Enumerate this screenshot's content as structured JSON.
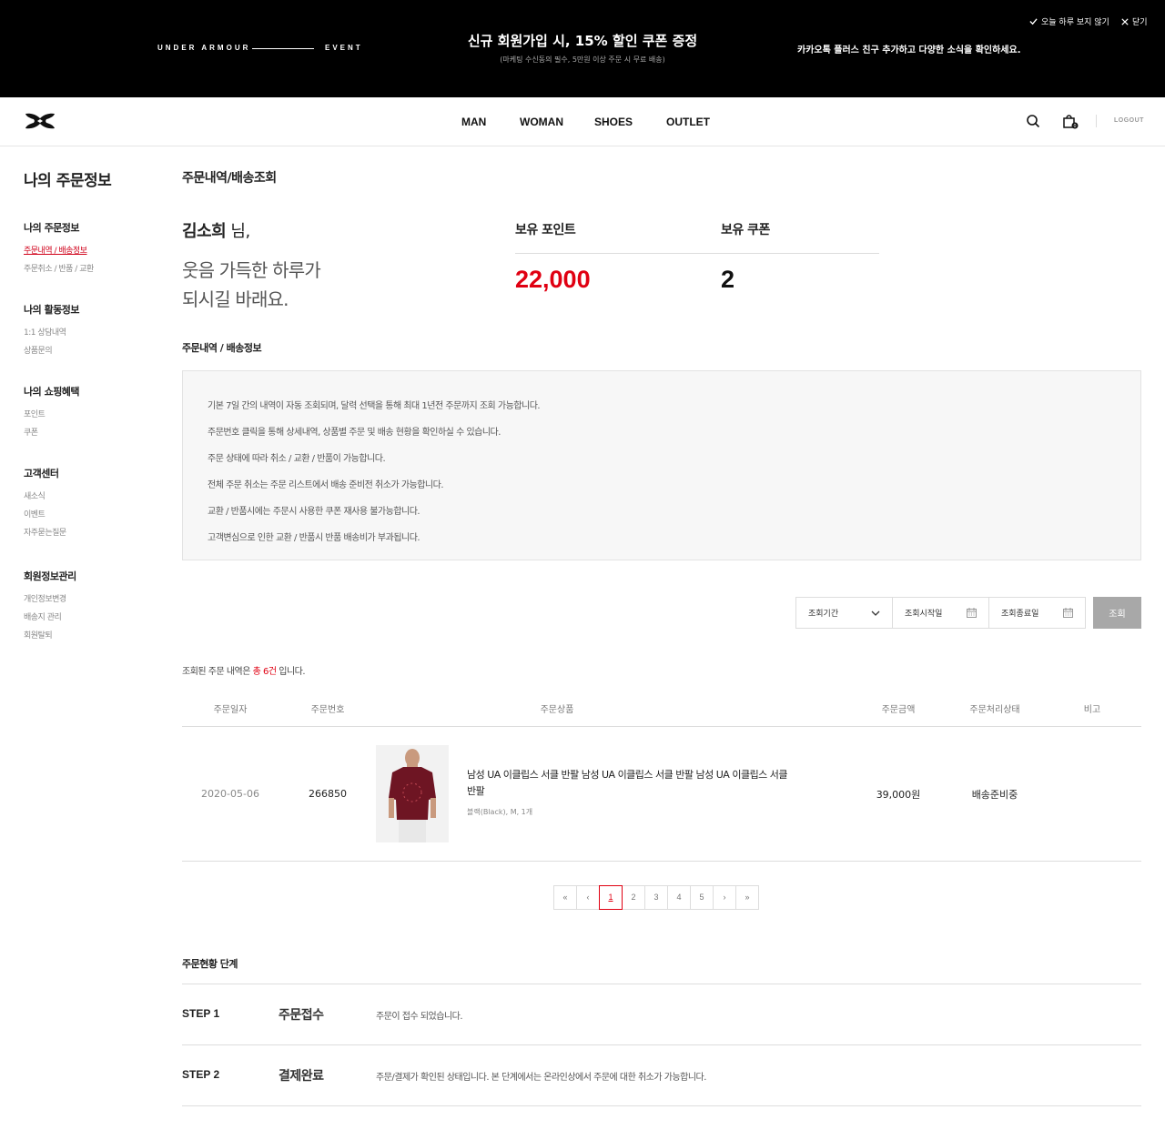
{
  "banner": {
    "brand": "UNDER ARMOUR",
    "event": "EVENT",
    "title": "신규 회원가입 시, 15% 할인 쿠폰 증정",
    "subtitle": "(마케팅 수신동의 필수, 5만원 이상 주문 시 무료 배송)",
    "kakao": "카카오톡 플러스 친구 추가하고 다양한 소식을 확인하세요.",
    "today_label": "오늘 하루 보지 않기",
    "close_label": "닫기"
  },
  "header": {
    "nav": [
      "MAN",
      "WOMAN",
      "SHOES",
      "OUTLET"
    ],
    "cart_count": "0",
    "logout": "LOGOUT"
  },
  "sidebar": {
    "title": "나의 주문정보",
    "groups": [
      {
        "title": "나의 주문정보",
        "items": [
          "주문내역 / 배송정보",
          "주문취소 / 반품 / 교환"
        ]
      },
      {
        "title": "나의 활동정보",
        "items": [
          "1:1 상담내역",
          "상품문의"
        ]
      },
      {
        "title": "나의 쇼핑혜택",
        "items": [
          "포인트",
          "쿠폰"
        ]
      },
      {
        "title": "고객센터",
        "items": [
          "새소식",
          "이벤트",
          "자주묻는질문"
        ]
      },
      {
        "title": "회원정보관리",
        "items": [
          "개인정보변경",
          "배송지 관리",
          "회원탈퇴"
        ]
      }
    ]
  },
  "main": {
    "title": "주문내역/배송조회",
    "user_name": "김소희",
    "user_suffix": " 님,",
    "greeting_line1": "웃음 가득한 하루가",
    "greeting_line2": "되시길 바래요.",
    "points_label": "보유 포인트",
    "points_value": "22,000",
    "coupons_label": "보유 쿠폰",
    "coupons_value": "2",
    "section_title": "주문내역 / 배송정보",
    "notices": [
      "기본 7일 간의 내역이 자동 조회되며, 달력 선택을 통해 최대 1년전 주문까지 조회 가능합니다.",
      "주문번호 클릭을 통해 상세내역, 상품별 주문 및 배송 현황을 확인하실 수 있습니다.",
      "주문 상태에 따라 취소 / 교환 / 반품이 가능합니다.",
      "전체 주문 취소는 주문 리스트에서 배송 준비전 취소가 가능합니다.",
      "교환 / 반품시에는 주문시 사용한 쿠폰 재사용 불가능합니다.",
      "고객변심으로 인한 교환 / 반품시 반품 배송비가 부과됩니다."
    ],
    "filter": {
      "period": "조회기간",
      "start": "조회시작일",
      "end": "조회종료일",
      "button": "조회"
    },
    "count_prefix": "조회된 주문 내역은 ",
    "count_value": "총 6건",
    "count_suffix": " 입니다.",
    "table": {
      "headers": [
        "주문일자",
        "주문번호",
        "주문상품",
        "주문금액",
        "주문처리상태",
        "비고"
      ],
      "rows": [
        {
          "date": "2020-05-06",
          "order_no": "266850",
          "product": "남성 UA 이클립스 서클 반팔 남성 UA 이클립스 서클 반팔 남성 UA 이클립스 서클 반팔",
          "option": "블랙(Black), M, 1개",
          "price": "39,000원",
          "status": "배송준비중",
          "note": ""
        }
      ]
    },
    "pager": [
      "«",
      "‹",
      "1",
      "2",
      "3",
      "4",
      "5",
      "›",
      "»"
    ],
    "current_page": "1",
    "steps_title": "주문현황 단계",
    "steps": [
      {
        "no": "STEP 1",
        "name": "주문접수",
        "desc": "주문이 접수 되었습니다."
      },
      {
        "no": "STEP 2",
        "name": "결제완료",
        "desc": "주문/결제가 확인된 상태입니다. 본 단계에서는 온라인상에서 주문에 대한 취소가 가능합니다."
      }
    ]
  },
  "colors": {
    "accent": "#e00012",
    "banner_bg": "#000000",
    "button_gray": "#a8a8a8"
  }
}
